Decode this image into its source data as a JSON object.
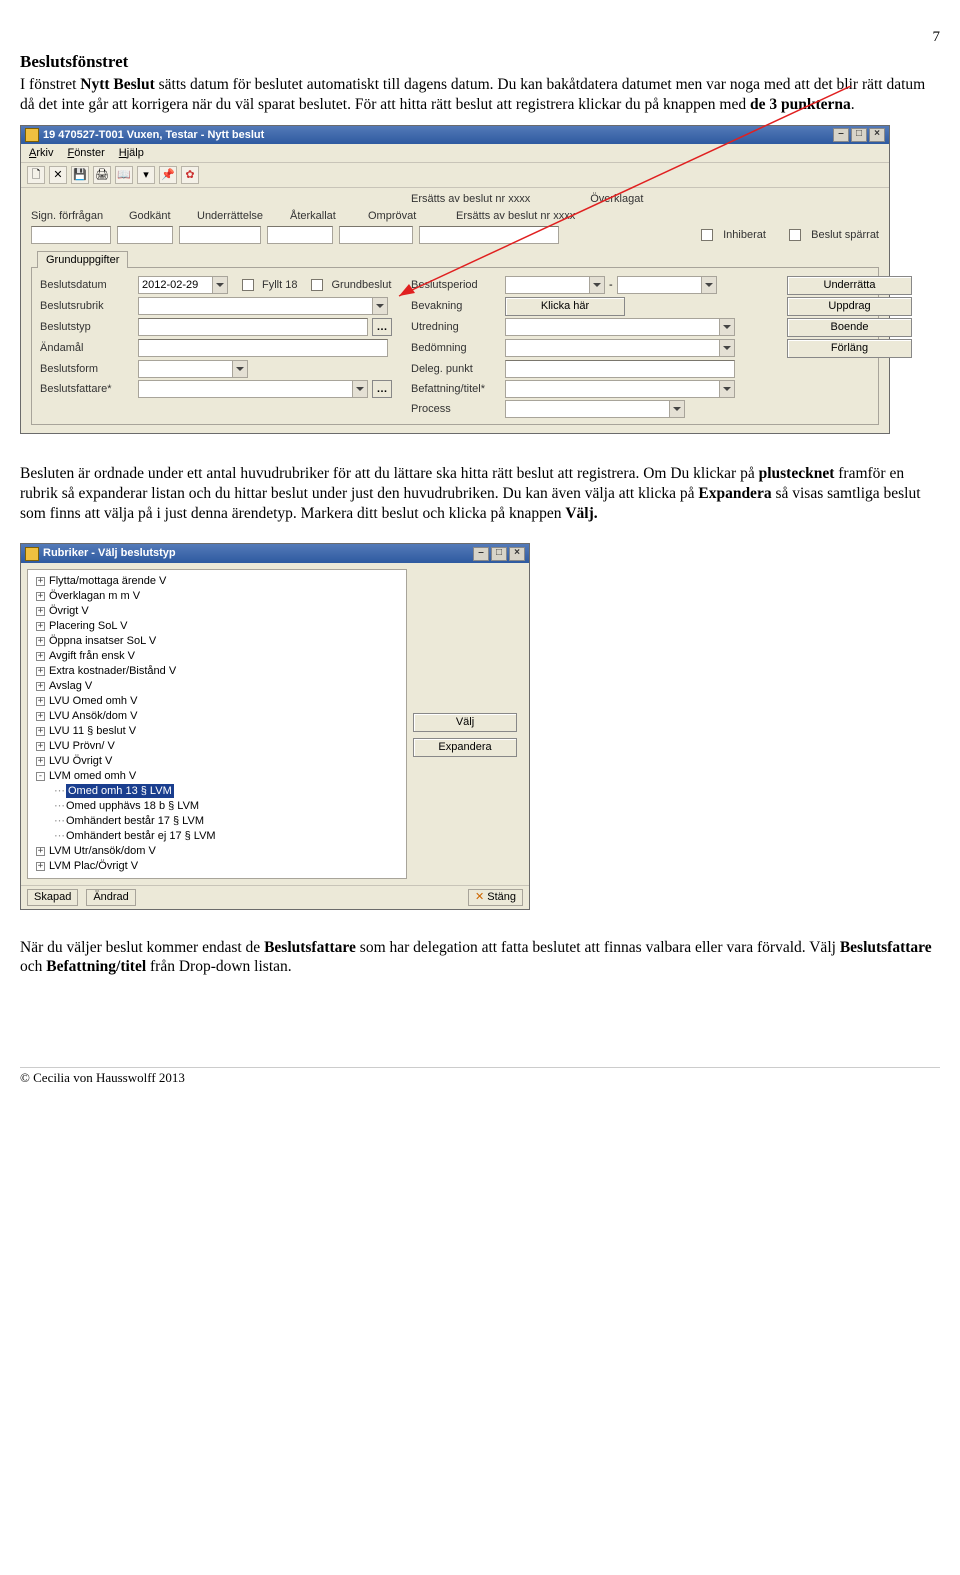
{
  "page_number": "7",
  "heading": "Beslutsfönstret",
  "para1_pre": "I fönstret ",
  "para1_b1": "Nytt Beslut",
  "para1_mid": " sätts datum för beslutet automatiskt till dagens datum. Du kan bakåtdatera datumet men var noga med att det blir rätt datum då det inte går att korrigera när du väl sparat beslutet. För att hitta rätt beslut att registrera klickar du på knappen med ",
  "para1_b2": "de 3 punkterna",
  "para1_end": ".",
  "win1": {
    "title": "19 470527-T001   Vuxen, Testar   -   Nytt beslut",
    "menu": [
      "Arkiv",
      "Fönster",
      "Hjälp"
    ],
    "header_row": {
      "c1": "Ersätts av beslut nr xxxx",
      "c2": "Överklagat"
    },
    "header_row2": {
      "a": "Sign. förfrågan",
      "b": "Godkänt",
      "c": "Underrättelse",
      "d": "Återkallat",
      "e": "Omprövat",
      "f": "Ersätts av beslut nr xxxx"
    },
    "top_checks": {
      "inhiberat": "Inhiberat",
      "spärrat": "Beslut spärrat"
    },
    "tab": "Grunduppgifter",
    "left_labels": {
      "beslutsdatum": "Beslutsdatum",
      "beslutsrubrik": "Beslutsrubrik",
      "beslutstyp": "Beslutstyp",
      "andamal": "Ändamål",
      "beslutsform": "Beslutsform",
      "beslutsfattare": "Beslutsfattare*"
    },
    "date_value": "2012-02-29",
    "left_checks": {
      "fyllt18": "Fyllt 18",
      "grundbeslut": "Grundbeslut"
    },
    "mid_labels": {
      "beslutsperiod": "Beslutsperiod",
      "bevakning": "Bevakning",
      "utredning": "Utredning",
      "bedomning": "Bedömning",
      "deleg": "Deleg. punkt",
      "befattning": "Befattning/titel*",
      "process": "Process"
    },
    "klicka_har": "Klicka här",
    "right_buttons": {
      "underratta": "Underrätta",
      "uppdrag": "Uppdrag",
      "boende": "Boende",
      "forlang": "Förläng"
    }
  },
  "para2_pre": "Besluten är ordnade under ett antal huvudrubriker för att du lättare ska hitta rätt beslut att registrera. Om Du klickar på ",
  "para2_b1": "plustecknet",
  "para2_mid1": " framför en rubrik så expanderar listan och du hittar beslut under just den huvudrubriken. Du kan även välja att klicka på ",
  "para2_b2": "Expandera",
  "para2_mid2": " så visas samtliga beslut som finns att välja på i just denna ärendetyp. Markera ditt beslut och klicka på knappen ",
  "para2_b3": "Välj.",
  "win2": {
    "title": "Rubriker - Välj beslutstyp",
    "tree": [
      {
        "exp": "+",
        "txt": "Flytta/mottaga ärende V"
      },
      {
        "exp": "+",
        "txt": "Överklagan m m V"
      },
      {
        "exp": "+",
        "txt": "Övrigt V"
      },
      {
        "exp": "+",
        "txt": "Placering SoL V"
      },
      {
        "exp": "+",
        "txt": "Öppna insatser SoL V"
      },
      {
        "exp": "+",
        "txt": "Avgift från ensk V"
      },
      {
        "exp": "+",
        "txt": "Extra kostnader/Bistånd V"
      },
      {
        "exp": "+",
        "txt": "Avslag V"
      },
      {
        "exp": "+",
        "txt": "LVU Omed omh V"
      },
      {
        "exp": "+",
        "txt": "LVU Ansök/dom V"
      },
      {
        "exp": "+",
        "txt": "LVU 11 § beslut V"
      },
      {
        "exp": "+",
        "txt": "LVU Prövn/ V"
      },
      {
        "exp": "+",
        "txt": "LVU Övrigt V"
      },
      {
        "exp": "-",
        "txt": "LVM omed omh V"
      },
      {
        "exp": "",
        "txt": "Omed omh 13 § LVM",
        "depth": 1,
        "selected": true
      },
      {
        "exp": "",
        "txt": "Omed upphävs 18 b § LVM",
        "depth": 1
      },
      {
        "exp": "",
        "txt": "Omhändert består 17 § LVM",
        "depth": 1
      },
      {
        "exp": "",
        "txt": "Omhändert består ej 17 § LVM",
        "depth": 1
      },
      {
        "exp": "+",
        "txt": "LVM Utr/ansök/dom V"
      },
      {
        "exp": "+",
        "txt": "LVM Plac/Övrigt V"
      }
    ],
    "right_buttons": {
      "valj": "Välj",
      "expandera": "Expandera"
    },
    "status": {
      "skapad": "Skapad",
      "andrad": "Ändrad",
      "stang": "Stäng"
    }
  },
  "para3_pre": "När du väljer beslut kommer endast de ",
  "para3_b1": "Beslutsfattare",
  "para3_mid1": " som har delegation att fatta beslutet att finnas valbara eller vara förvald. Välj ",
  "para3_b2": "Beslutsfattare",
  "para3_mid2": " och ",
  "para3_b3": "Befattning/titel",
  "para3_end": " från Drop-down listan.",
  "footer": "© Cecilia von Hausswolff 2013"
}
